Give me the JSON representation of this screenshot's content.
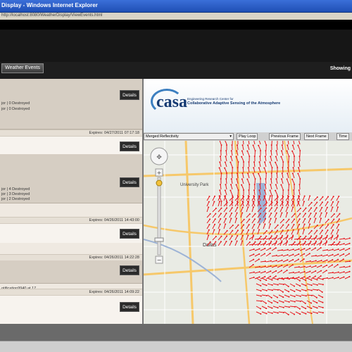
{
  "window": {
    "title": "Display - Windows Internet Explorer",
    "url": "http://localhost:8080/WeatherDisplay/ViewEvents.html"
  },
  "nav": {
    "weather_events_tab": "Weather Events",
    "showing_label": "Showing"
  },
  "events": [
    {
      "lines": [
        "jor  |  0 Destroyed",
        "jor  |  0 Destroyed"
      ],
      "details": "Details",
      "expires_label": "Expires:",
      "expires_value": "04/27/2011  07:17:18"
    },
    {
      "lines": [
        "jor  |  4 Destroyed",
        "jor  |  3 Destroyed",
        "jor  |  2 Destroyed"
      ],
      "details": "Details",
      "expires_label": "Expires:",
      "expires_value": "04/26/2011  14:43:00"
    },
    {
      "lines": [],
      "details": "Details",
      "expires_label": "Expires:",
      "expires_value": "04/26/2011  14:22:28"
    },
    {
      "lines": [
        "otification9940 at 17..."
      ],
      "details": "Details",
      "expires_label": "Expires:",
      "expires_value": "04/26/2011  14:09:22"
    }
  ],
  "extra_details": [
    "Details",
    "Details"
  ],
  "casa": {
    "logo": "casa",
    "line1": "Engineering Research Center for",
    "line2": "Collaborative Adaptive Sensing of the Atmosphere"
  },
  "map_toolbar": {
    "layer_select": "Merged Reflectivity",
    "play_loop": "Play Loop",
    "previous_frame": "Previous Frame",
    "next_frame": "Next Frame",
    "time": "Time"
  },
  "map": {
    "city_label": "Dallas",
    "park_label": "University Park",
    "arrow_color": "#e8141a",
    "water_color": "#9db3d6",
    "road_color": "#ffffff",
    "highway_color": "#f6c86a"
  }
}
